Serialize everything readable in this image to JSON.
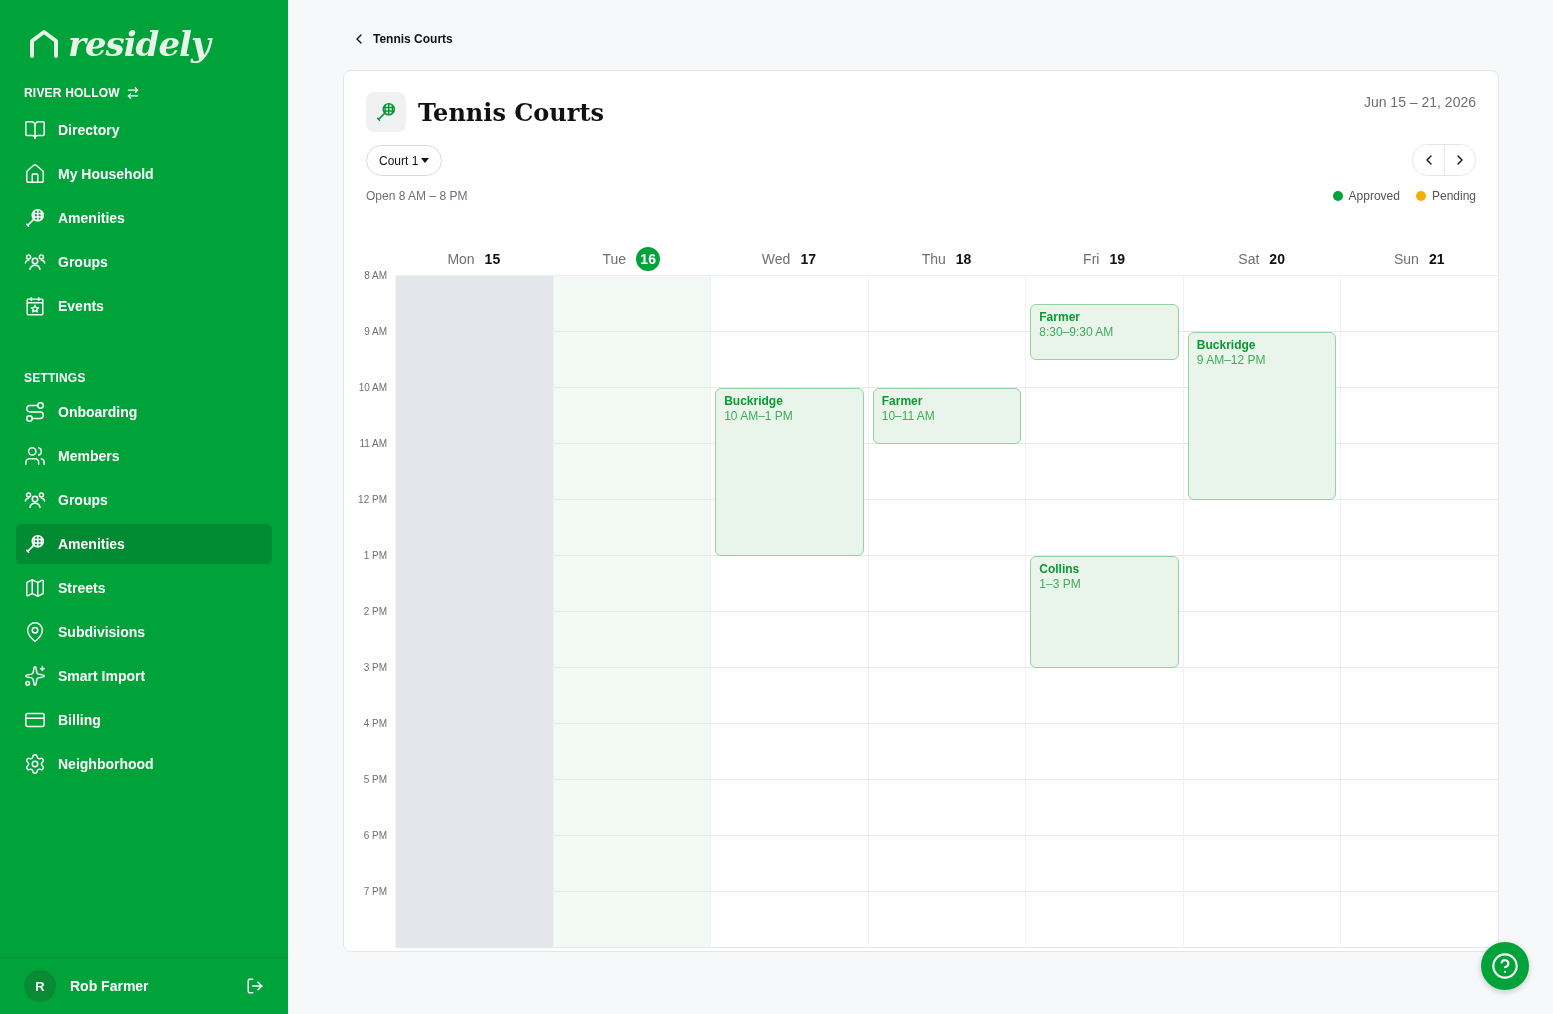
{
  "brand": {
    "name": "residely"
  },
  "community": {
    "name": "RIVER HOLLOW"
  },
  "nav": [
    {
      "kind": "book",
      "label": "Directory",
      "selected": false
    },
    {
      "kind": "home",
      "label": "My Household",
      "selected": false
    },
    {
      "kind": "racket",
      "label": "Amenities",
      "selected": false
    },
    {
      "kind": "group",
      "label": "Groups",
      "selected": false
    },
    {
      "kind": "calendar",
      "label": "Events",
      "selected": false
    }
  ],
  "settings": {
    "heading": "SETTINGS",
    "items": [
      {
        "kind": "route",
        "label": "Onboarding",
        "selected": false
      },
      {
        "kind": "users",
        "label": "Members",
        "selected": false
      },
      {
        "kind": "group",
        "label": "Groups",
        "selected": false
      },
      {
        "kind": "racket",
        "label": "Amenities",
        "selected": true
      },
      {
        "kind": "map",
        "label": "Streets",
        "selected": false
      },
      {
        "kind": "pin",
        "label": "Subdivisions",
        "selected": false
      },
      {
        "kind": "sparkles",
        "label": "Smart Import",
        "selected": false
      },
      {
        "kind": "card",
        "label": "Billing",
        "selected": false
      },
      {
        "kind": "gear",
        "label": "Neighborhood",
        "selected": false
      }
    ]
  },
  "user": {
    "initial": "R",
    "name": "Rob Farmer"
  },
  "back": {
    "label": "Tennis Courts"
  },
  "amenity": {
    "title": "Tennis Courts",
    "date_range": "Jun 15 – 21, 2026",
    "court": "Court 1",
    "hours": "Open 8 AM – 8 PM"
  },
  "legend": [
    {
      "label": "Approved",
      "color": "#00a23a"
    },
    {
      "label": "Pending",
      "color": "#f2b000"
    }
  ],
  "times": [
    "8 AM",
    "9 AM",
    "10 AM",
    "11 AM",
    "12 PM",
    "1 PM",
    "2 PM",
    "3 PM",
    "4 PM",
    "5 PM",
    "6 PM",
    "7 PM"
  ],
  "days": [
    {
      "name": "Mon",
      "date": "15",
      "past": true,
      "today": false
    },
    {
      "name": "Tue",
      "date": "16",
      "past": false,
      "today": true
    },
    {
      "name": "Wed",
      "date": "17",
      "past": false,
      "today": false,
      "events": [
        {
          "name": "Buckridge",
          "time": "10 AM–1 PM"
        }
      ]
    },
    {
      "name": "Thu",
      "date": "18",
      "past": false,
      "today": false,
      "events": [
        {
          "name": "Farmer",
          "time": "10–11 AM"
        }
      ]
    },
    {
      "name": "Fri",
      "date": "19",
      "past": false,
      "today": false,
      "events": [
        {
          "name": "Farmer",
          "time": "8:30–9:30 AM"
        },
        {
          "name": "Collins",
          "time": "1–3 PM"
        }
      ]
    },
    {
      "name": "Sat",
      "date": "20",
      "past": false,
      "today": false,
      "events": [
        {
          "name": "Buckridge",
          "time": "9 AM–12 PM"
        }
      ]
    },
    {
      "name": "Sun",
      "date": "21",
      "past": false,
      "today": false
    }
  ]
}
